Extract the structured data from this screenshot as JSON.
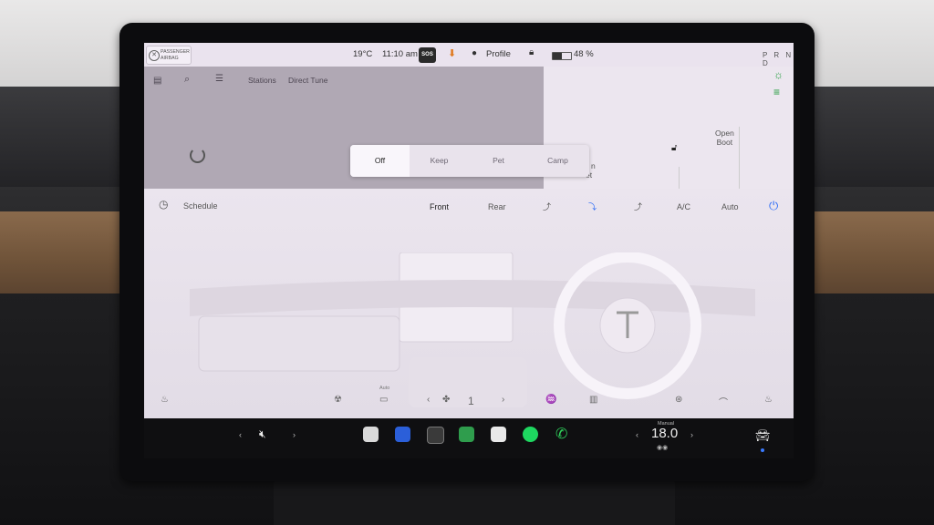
{
  "status": {
    "airbag_line1": "PASSENGER",
    "airbag_line2": "AIRBAG",
    "temperature": "19°C",
    "time": "11:10 am",
    "sos": "SOS",
    "profile": "Profile",
    "battery": "48 %",
    "battery_level": 0.48,
    "gear": "P R N D"
  },
  "media": {
    "stations": "Stations",
    "direct_tune": "Direct Tune"
  },
  "car": {
    "open_line1": "Open",
    "open_line2": "Boot",
    "partial_label_top": "n",
    "partial_label_bottom": "et"
  },
  "climate_modes": [
    "Off",
    "Keep",
    "Pet",
    "Camp"
  ],
  "climate": {
    "schedule": "Schedule",
    "front": "Front",
    "rear": "Rear",
    "ac": "A/C",
    "auto": "Auto",
    "fan_auto": "Auto",
    "fan_speed": "1"
  },
  "dock": {
    "driver_temp_label": "Manual",
    "driver_temp": "18.0"
  },
  "colors": {
    "accent_blue": "#2f6df6",
    "light_green": "#1f9b3a",
    "media_panel": "#b0a8b4"
  }
}
